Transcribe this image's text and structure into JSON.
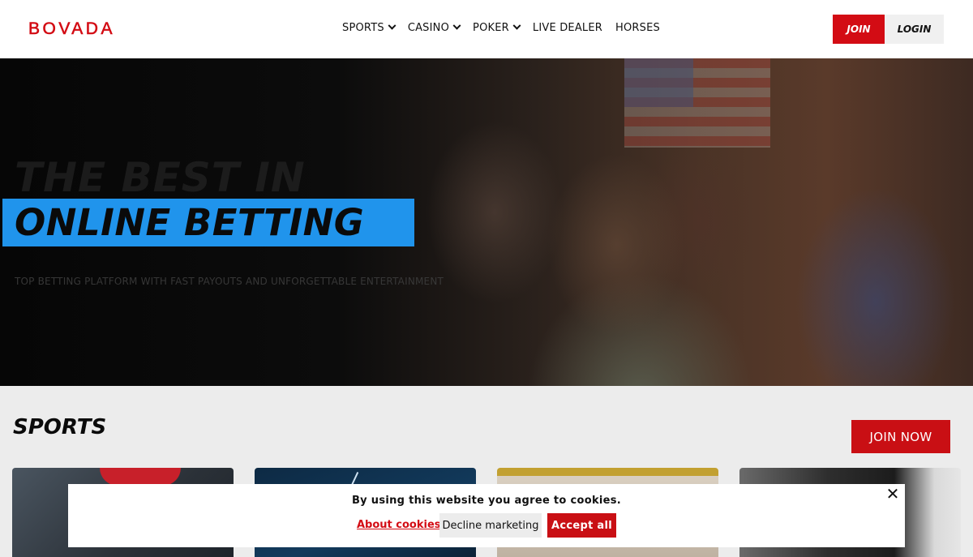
{
  "header": {
    "logo": "BOVADA",
    "nav": [
      {
        "label": "SPORTS",
        "has_dropdown": true
      },
      {
        "label": "CASINO",
        "has_dropdown": true
      },
      {
        "label": "POKER",
        "has_dropdown": true
      },
      {
        "label": "LIVE DEALER",
        "has_dropdown": false
      },
      {
        "label": "HORSES",
        "has_dropdown": false
      }
    ],
    "join_label": "JOIN",
    "login_label": "LOGIN"
  },
  "hero": {
    "title_line1": "THE BEST IN",
    "title_line2": "ONLINE BETTING",
    "subtitle": "TOP BETTING PLATFORM WITH FAST PAYOUTS AND UNFORGETTABLE ENTERTAINMENT"
  },
  "sports": {
    "title": "SPORTS",
    "join_now_label": "JOIN NOW"
  },
  "cookie_banner": {
    "message": "By using this website you agree to cookies.",
    "about_link": "About cookies",
    "decline_label": "Decline marketing",
    "accept_label": "Accept all",
    "close_icon": "close-icon"
  },
  "colors": {
    "brand_red": "#d30c14",
    "hero_highlight": "#2094ec"
  }
}
